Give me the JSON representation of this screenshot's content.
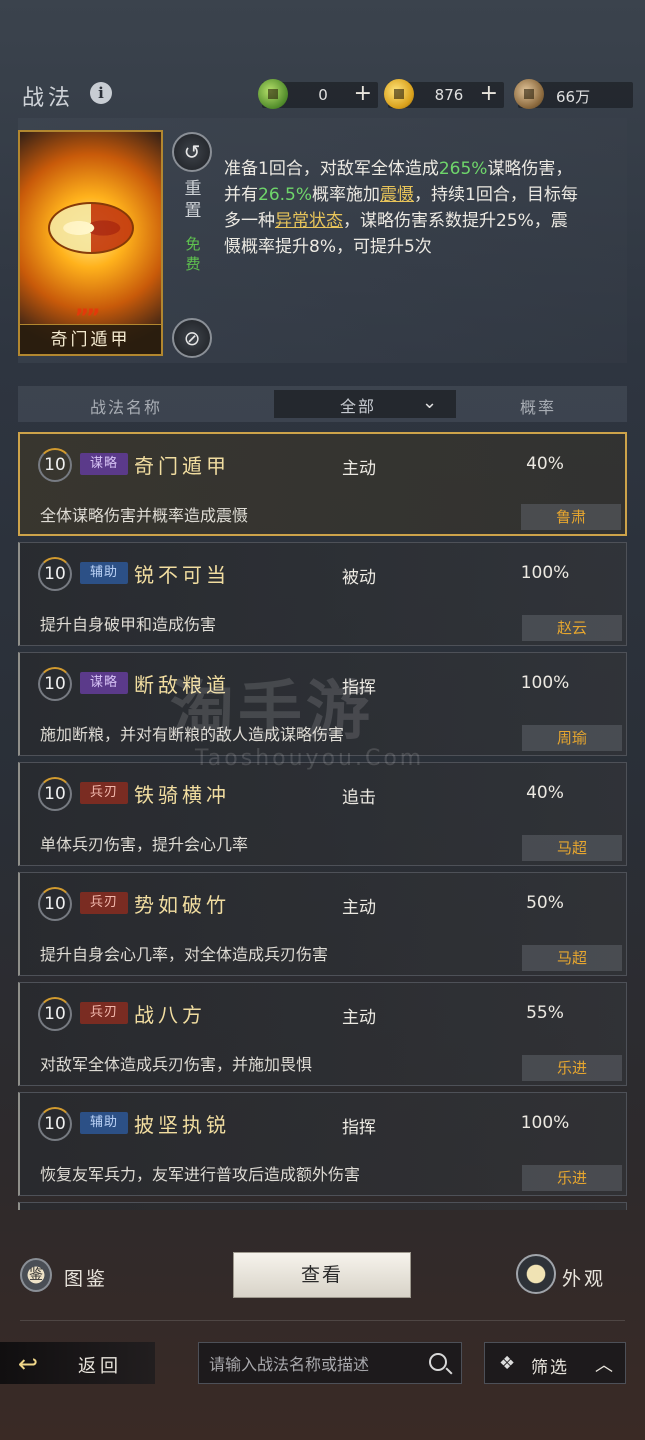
{
  "header": {
    "title": "战法",
    "currencies": [
      {
        "icon": "jade-coin-icon",
        "value": "0",
        "plus": "+"
      },
      {
        "icon": "gold-coin-icon",
        "value": "876",
        "plus": "+"
      },
      {
        "icon": "copper-coin-icon",
        "value": "66万"
      }
    ]
  },
  "skill_detail": {
    "card_name": "奇门遁甲",
    "reset_label": "重置",
    "free_label": "免费",
    "description": {
      "p1": "准备1回合，对敌军全体造成",
      "v1": "265%",
      "p2": "谋略伤害，并有",
      "v2": "26.5%",
      "p3": "概率施加",
      "v3": "震慑",
      "p4": "，持续1回合，目标每多一种",
      "v4": "异常状态",
      "p5": "，谋略伤害系数提升25%，震慑概率提升8%，可提升5次"
    }
  },
  "table_header": {
    "name_col": "战法名称",
    "filter_value": "全部",
    "rate_col": "概率"
  },
  "skills": [
    {
      "level": "10",
      "tag": "谋略",
      "name": "奇门遁甲",
      "type": "主动",
      "rate": "40%",
      "desc": "全体谋略伤害并概率造成震慑",
      "hero": "鲁肃"
    },
    {
      "level": "10",
      "tag": "辅助",
      "name": "锐不可当",
      "type": "被动",
      "rate": "100%",
      "desc": "提升自身破甲和造成伤害",
      "hero": "赵云"
    },
    {
      "level": "10",
      "tag": "谋略",
      "name": "断敌粮道",
      "type": "指挥",
      "rate": "100%",
      "desc": "施加断粮，并对有断粮的敌人造成谋略伤害",
      "hero": "周瑜"
    },
    {
      "level": "10",
      "tag": "兵刃",
      "name": "铁骑横冲",
      "type": "追击",
      "rate": "40%",
      "desc": "单体兵刃伤害，提升会心几率",
      "hero": "马超"
    },
    {
      "level": "10",
      "tag": "兵刃",
      "name": "势如破竹",
      "type": "主动",
      "rate": "50%",
      "desc": "提升自身会心几率，对全体造成兵刃伤害",
      "hero": "马超"
    },
    {
      "level": "10",
      "tag": "兵刃",
      "name": "战八方",
      "type": "主动",
      "rate": "55%",
      "desc": "对敌军全体造成兵刃伤害，并施加畏惧",
      "hero": "乐进"
    },
    {
      "level": "10",
      "tag": "辅助",
      "name": "披坚执锐",
      "type": "指挥",
      "rate": "100%",
      "desc": "恢复友军兵力，友军进行普攻后造成额外伤害",
      "hero": "乐进"
    }
  ],
  "watermark": {
    "main": "淘手游",
    "sub": "Taoshouyou.Com"
  },
  "bottom": {
    "book_icon_text": "鉴",
    "book_label": "图鉴",
    "view_button": "查看",
    "appearance_label": "外观"
  },
  "footer": {
    "back_label": "返回",
    "search_placeholder": "请输入战法名称或描述",
    "filter_label": "筛选"
  },
  "colors": {
    "accent_gold": "#cda34a",
    "highlight_green": "#6fd66b",
    "hero_orange": "#e6a62f"
  }
}
